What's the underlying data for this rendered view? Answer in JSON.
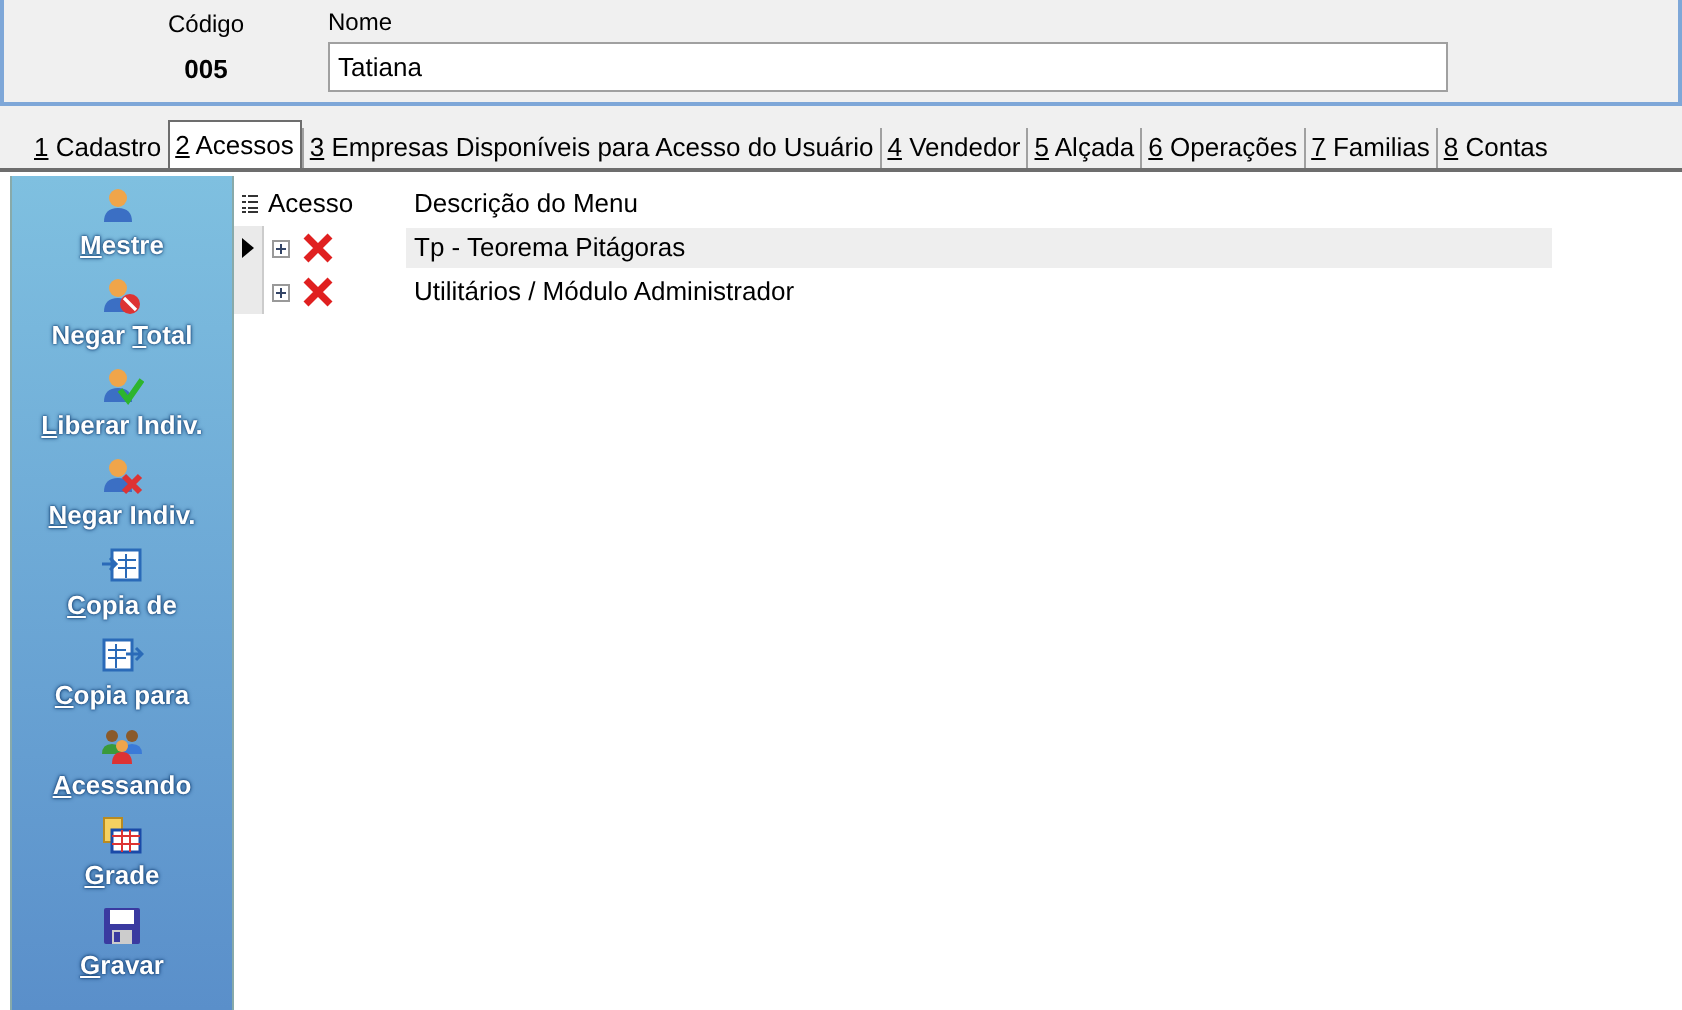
{
  "header": {
    "code_label": "Código",
    "code_value": "005",
    "name_label": "Nome",
    "name_value": "Tatiana"
  },
  "tabs": [
    {
      "key": "1",
      "label": "Cadastro",
      "selected": false
    },
    {
      "key": "2",
      "label": "Acessos",
      "selected": true
    },
    {
      "key": "3",
      "label": "Empresas Disponíveis para Acesso do Usuário",
      "selected": false
    },
    {
      "key": "4",
      "label": "Vendedor",
      "selected": false
    },
    {
      "key": "5",
      "label": "Alçada",
      "selected": false
    },
    {
      "key": "6",
      "label": "Operações",
      "selected": false
    },
    {
      "key": "7",
      "label": "Familias",
      "selected": false
    },
    {
      "key": "8",
      "label": "Contas",
      "selected": false
    }
  ],
  "sidebar": [
    {
      "kind": "master",
      "key": "M",
      "after": "estre"
    },
    {
      "kind": "deny-all",
      "before": "Negar ",
      "key": "T",
      "after": "otal"
    },
    {
      "kind": "allow-one",
      "key": "L",
      "after": "iberar Indiv."
    },
    {
      "kind": "deny-one",
      "key": "N",
      "after": "egar Indiv."
    },
    {
      "kind": "copy-from",
      "key": "C",
      "after": "opia de"
    },
    {
      "kind": "copy-to",
      "key": "C",
      "after": "opia para"
    },
    {
      "kind": "users",
      "key": "A",
      "after": "cessando"
    },
    {
      "kind": "grid",
      "key": "G",
      "after": "rade"
    },
    {
      "kind": "save",
      "key": "G",
      "after": "ravar"
    }
  ],
  "grid": {
    "columns": [
      "Acesso",
      "Descrição do Menu"
    ],
    "rows": [
      {
        "selected": true,
        "expanded": false,
        "access": false,
        "description": "Tp - Teorema Pitágoras"
      },
      {
        "selected": false,
        "expanded": false,
        "access": false,
        "description": "Utilitários / Módulo Administrador"
      }
    ]
  }
}
